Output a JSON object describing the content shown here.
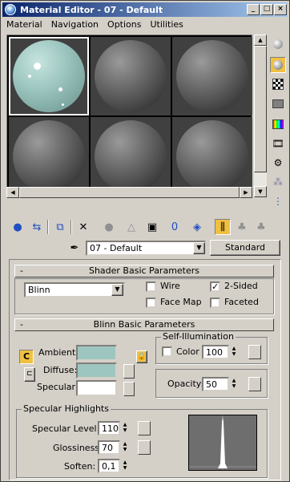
{
  "window": {
    "title": "Material Editor - 07 - Default"
  },
  "titlebar_buttons": [
    "_",
    "□",
    "×"
  ],
  "menu": [
    "Material",
    "Navigation",
    "Options",
    "Utilities"
  ],
  "sample_slots": [
    {
      "material": "07 - Default",
      "active": true
    },
    {
      "active": false
    },
    {
      "active": false
    },
    {
      "active": false
    },
    {
      "active": false
    },
    {
      "active": false
    }
  ],
  "side_toolbar_icons": [
    "sample-type-sphere-icon",
    "backlight-icon",
    "background-checker-icon",
    "sample-uv-tiling-icon",
    "video-color-check-icon",
    "make-preview-icon",
    "options-icon",
    "select-by-material-icon",
    "material-map-navigator-icon"
  ],
  "main_toolbar_icons": [
    "get-material-icon",
    "put-to-scene-icon",
    "assign-to-selection-icon",
    "reset-map-icon",
    "make-unique-icon",
    "copy-material-icon",
    "put-to-library-icon",
    "material-effects-channel-icon",
    "show-map-in-viewport-icon",
    "show-end-result-icon",
    "go-to-parent-icon",
    "go-forward-to-sibling-icon"
  ],
  "material_name": "07 - Default",
  "material_type": "Standard",
  "shader_rollout": {
    "title": "Shader Basic Parameters",
    "collapse": "-",
    "shader": "Blinn",
    "wire": {
      "label": "Wire",
      "checked": false
    },
    "two_sided": {
      "label": "2-Sided",
      "checked": true
    },
    "face_map": {
      "label": "Face Map",
      "checked": false
    },
    "faceted": {
      "label": "Faceted",
      "checked": false
    }
  },
  "blinn_rollout": {
    "title": "Blinn Basic Parameters",
    "collapse": "-",
    "ambient": {
      "label": "Ambient:",
      "color": "#9ec6c0"
    },
    "diffuse": {
      "label": "Diffuse:",
      "color": "#9ec6c0"
    },
    "specular": {
      "label": "Specular:",
      "color": "#ffffff"
    },
    "lock_letter": "C",
    "self_illum": {
      "group": "Self-Illumination",
      "label": "Color",
      "value": "100",
      "checked": false
    },
    "opacity": {
      "label": "Opacity:",
      "value": "50"
    },
    "specular_highlights": {
      "group": "Specular Highlights",
      "specular_level": {
        "label": "Specular Level:",
        "value": "110"
      },
      "glossiness": {
        "label": "Glossiness:",
        "value": "70"
      },
      "soften": {
        "label": "Soften:",
        "value": "0,1"
      }
    }
  },
  "colors": {
    "title_start": "#0a246a",
    "title_end": "#a6caf0",
    "face": "#d4d0c8",
    "active_sphere": "#9ec6c0"
  }
}
